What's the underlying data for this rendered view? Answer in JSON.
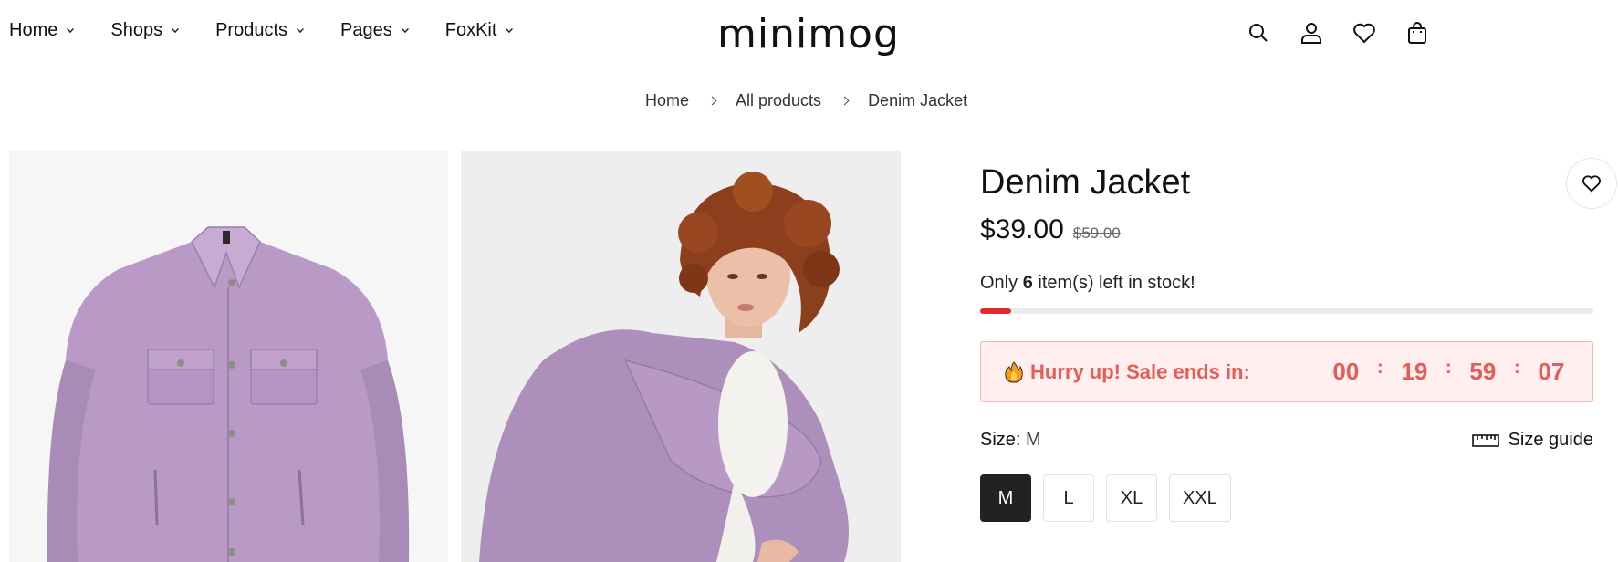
{
  "header": {
    "nav": [
      {
        "label": "Home"
      },
      {
        "label": "Shops"
      },
      {
        "label": "Products"
      },
      {
        "label": "Pages"
      },
      {
        "label": "FoxKit"
      }
    ],
    "logo": "minimog",
    "icons": [
      "search-icon",
      "account-icon",
      "wishlist-icon",
      "cart-icon"
    ]
  },
  "breadcrumb": [
    "Home",
    "All products",
    "Denim Jacket"
  ],
  "product": {
    "title": "Denim Jacket",
    "price": "$39.00",
    "compare_price": "$59.00",
    "stock": {
      "prefix": "Only",
      "count": "6",
      "suffix": "item(s) left in stock!",
      "level": 0.05
    },
    "countdown": {
      "message": "Hurry up! Sale ends in:",
      "days": "00",
      "hours": "19",
      "minutes": "59",
      "seconds": "07",
      "separator": ":"
    },
    "size": {
      "label": "Size:",
      "selected": "M",
      "guide_label": "Size guide",
      "options": [
        "M",
        "L",
        "XL",
        "XXL"
      ]
    }
  },
  "colors": {
    "accent_red": "#e02b2b",
    "countdown_text": "#e85c57",
    "countdown_bg": "#fff0ef",
    "jacket": "#b99ac6"
  }
}
